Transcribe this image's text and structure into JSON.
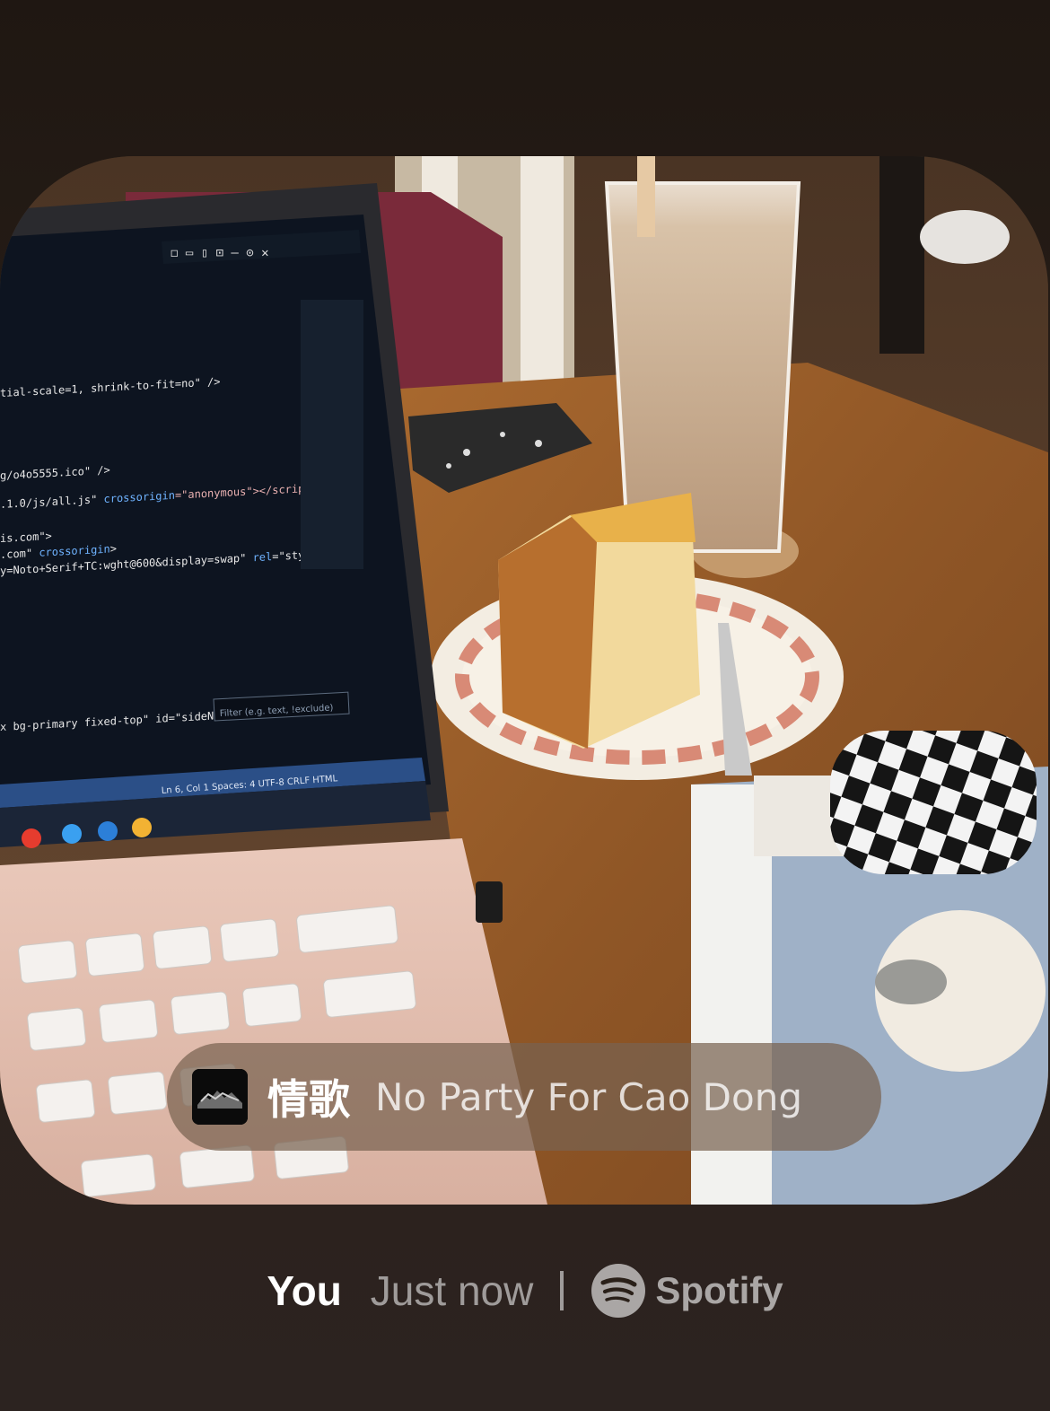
{
  "now_playing": {
    "track_title": "情歌",
    "artist": "No Party For Cao Dong"
  },
  "footer": {
    "user": "You",
    "timestamp": "Just now",
    "brand": "Spotify"
  },
  "photo": {
    "laptop_status_bar": "Ln 6, Col 1   Spaces: 4   UTF-8   CRLF   HTML",
    "laptop_filter_placeholder": "Filter (e.g. text, !exclude)"
  },
  "colors": {
    "table_wood": "#9a5e2c",
    "laptop_screen": "#0d1420",
    "laptop_body": "#e5c3b3",
    "drink": "#c9a98a",
    "cake": "#f1d69a"
  },
  "icons": {
    "brand_icon": "spotify-icon",
    "album_art": "album-art-thumbnail"
  }
}
